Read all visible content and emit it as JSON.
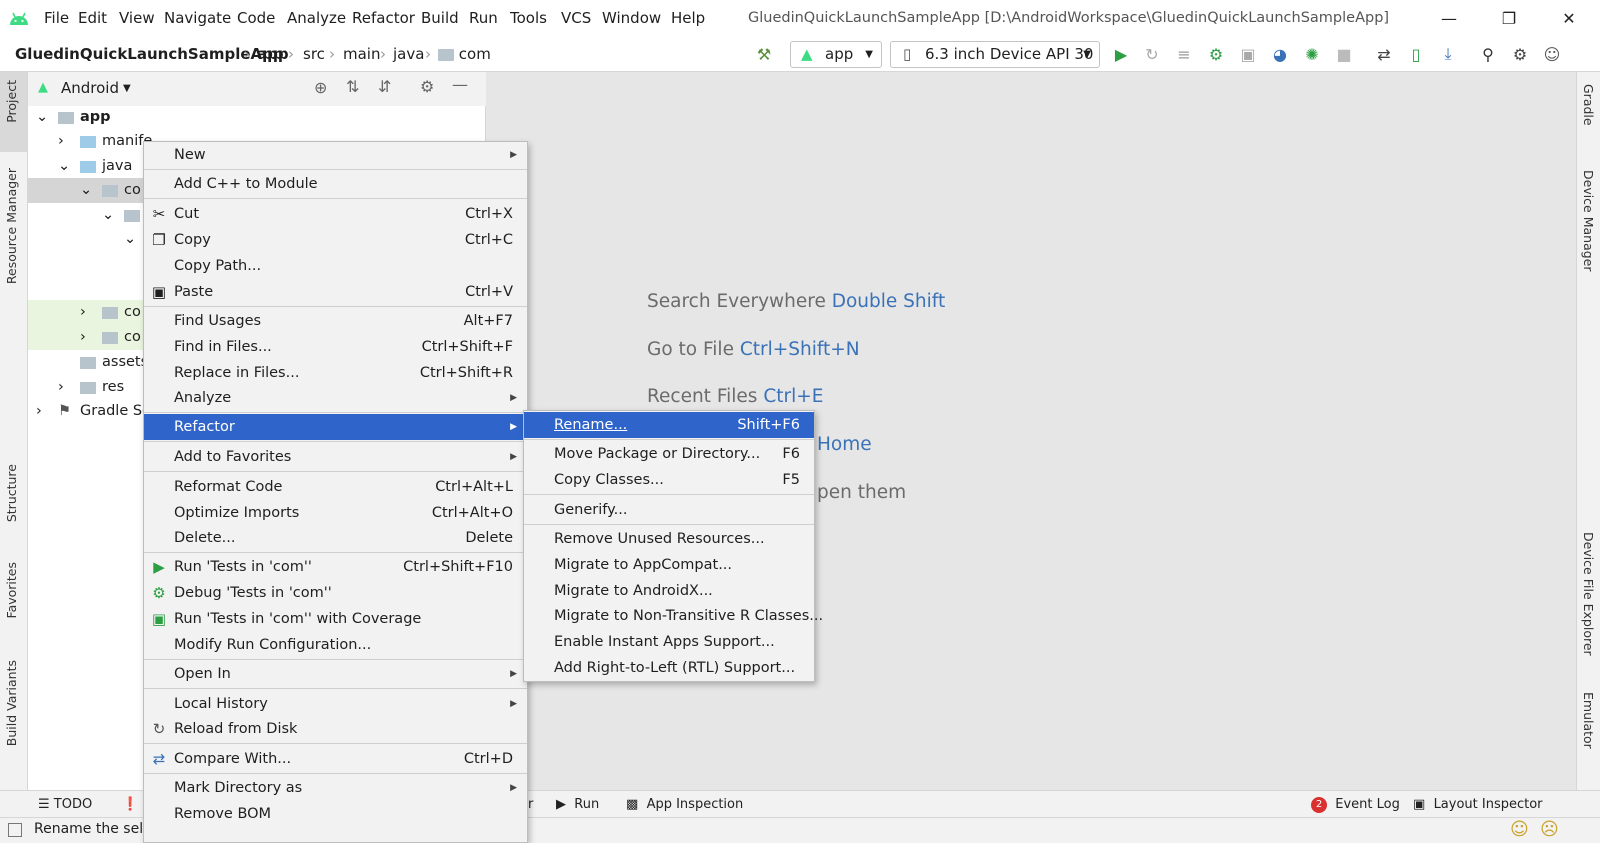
{
  "colors": {
    "accent": "#2f65ca",
    "android_green": "#3ddc84",
    "hint_key": "#3a72b8",
    "run_green": "#2e9e44"
  },
  "titlebar": {
    "menus": [
      "File",
      "Edit",
      "View",
      "Navigate",
      "Code",
      "Analyze",
      "Refactor",
      "Build",
      "Run",
      "Tools",
      "VCS",
      "Window",
      "Help"
    ],
    "title": "GluedinQuickLaunchSampleApp [D:\\AndroidWorkspace\\GluedinQuickLaunchSampleApp]"
  },
  "navbar": {
    "crumbs": [
      "GluedinQuickLaunchSampleApp",
      "app",
      "src",
      "main",
      "java",
      "com"
    ],
    "run_config": "app",
    "device": "6.3 inch Device API 30"
  },
  "project": {
    "view_mode": "Android",
    "tree": {
      "app": "app",
      "manifests": "manife",
      "java": "java",
      "com_selected": "co",
      "com2": "co",
      "com3": "co",
      "assets": "assets",
      "res": "res",
      "gradle": "Gradle Sc"
    }
  },
  "left_tabs": [
    "Project",
    "Resource Manager",
    "Structure",
    "Favorites",
    "Build Variants"
  ],
  "right_tabs": [
    "Gradle",
    "Device Manager",
    "Device File Explorer",
    "Emulator"
  ],
  "editor_hints": {
    "search": "Search Everywhere",
    "search_key": "Double Shift",
    "goto": "Go to File",
    "goto_key": "Ctrl+Shift+N",
    "recent": "Recent Files",
    "recent_key": "Ctrl+E",
    "home": "Home",
    "open": "pen them"
  },
  "context_menu": {
    "new": "New",
    "add_cpp": "Add C++ to Module",
    "cut": "Cut",
    "cut_sc": "Ctrl+X",
    "copy": "Copy",
    "copy_sc": "Ctrl+C",
    "copy_path": "Copy Path...",
    "paste": "Paste",
    "paste_sc": "Ctrl+V",
    "find_usages": "Find Usages",
    "find_usages_sc": "Alt+F7",
    "find_in_files": "Find in Files...",
    "find_in_files_sc": "Ctrl+Shift+F",
    "replace_in_files": "Replace in Files...",
    "replace_in_files_sc": "Ctrl+Shift+R",
    "analyze": "Analyze",
    "refactor": "Refactor",
    "add_favorites": "Add to Favorites",
    "reformat": "Reformat Code",
    "reformat_sc": "Ctrl+Alt+L",
    "optimize": "Optimize Imports",
    "optimize_sc": "Ctrl+Alt+O",
    "delete": "Delete...",
    "delete_sc": "Delete",
    "run_tests": "Run 'Tests in 'com''",
    "run_tests_sc": "Ctrl+Shift+F10",
    "debug_tests": "Debug 'Tests in 'com''",
    "run_coverage": "Run 'Tests in 'com'' with Coverage",
    "modify_run": "Modify Run Configuration...",
    "open_in": "Open In",
    "local_history": "Local History",
    "reload": "Reload from Disk",
    "compare": "Compare With...",
    "compare_sc": "Ctrl+D",
    "mark_dir": "Mark Directory as",
    "remove_bom": "Remove BOM"
  },
  "refactor_menu": {
    "rename": "Rename...",
    "rename_sc": "Shift+F6",
    "move": "Move Package or Directory...",
    "move_sc": "F6",
    "copy_classes": "Copy Classes...",
    "copy_classes_sc": "F5",
    "generify": "Generify...",
    "remove_unused": "Remove Unused Resources...",
    "migrate_appcompat": "Migrate to AppCompat...",
    "migrate_androidx": "Migrate to AndroidX...",
    "migrate_nontransitive": "Migrate to Non-Transitive R Classes...",
    "instant_apps": "Enable Instant Apps Support...",
    "rtl": "Add Right-to-Left (RTL) Support..."
  },
  "bottom_tools": {
    "todo": "TODO",
    "r": "r",
    "run": "Run",
    "app_inspection": "App Inspection",
    "event_log_badge": "2",
    "event_log": "Event Log",
    "layout_inspector": "Layout Inspector"
  },
  "status": {
    "message": "Rename the selec"
  }
}
